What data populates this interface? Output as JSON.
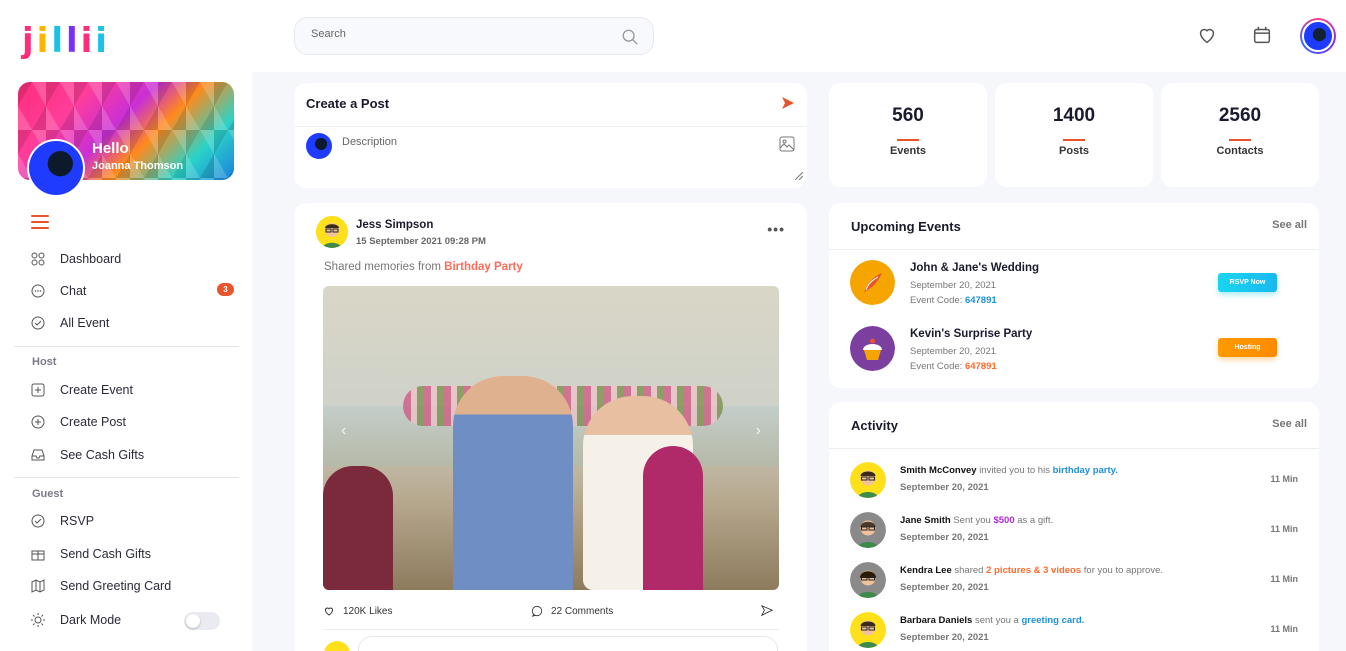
{
  "brand": {
    "logo_text": "jillii"
  },
  "search": {
    "placeholder": "Search"
  },
  "profile": {
    "greeting": "Hello",
    "name": "Joanna Thomson"
  },
  "sidebar": {
    "main_items": [
      {
        "label": "Dashboard",
        "icon": "dashboard-icon"
      },
      {
        "label": "Chat",
        "icon": "chat-icon",
        "badge": "3"
      },
      {
        "label": "All Event",
        "icon": "check-circle-icon"
      }
    ],
    "host_label": "Host",
    "host_items": [
      {
        "label": "Create Event",
        "icon": "plus-square-icon"
      },
      {
        "label": "Create Post",
        "icon": "plus-circle-icon"
      },
      {
        "label": "See Cash Gifts",
        "icon": "inbox-icon"
      }
    ],
    "guest_label": "Guest",
    "guest_items": [
      {
        "label": "RSVP",
        "icon": "check-circle-icon"
      },
      {
        "label": "Send Cash Gifts",
        "icon": "gift-icon"
      },
      {
        "label": "Send Greeting Card",
        "icon": "map-icon"
      }
    ],
    "dark_mode_label": "Dark Mode",
    "dark_mode_on": false
  },
  "create_post": {
    "title": "Create a Post",
    "placeholder": "Description"
  },
  "stats": [
    {
      "value": "560",
      "label": "Events"
    },
    {
      "value": "1400",
      "label": "Posts"
    },
    {
      "value": "2560",
      "label": "Contacts"
    }
  ],
  "post": {
    "author": "Jess Simpson",
    "date": "15 September 2021 09:28 PM",
    "caption_prefix": "Shared memories from",
    "caption_highlight": "Birthday Party",
    "likes": "120K Likes",
    "comments": "22 Comments"
  },
  "upcoming_events": {
    "title": "Upcoming Events",
    "see_all": "See all",
    "items": [
      {
        "title": "John & Jane's Wedding",
        "date": "September 20, 2021",
        "code_label": "Event Code:",
        "code": "647891",
        "code_color": "#1e90d6",
        "button": "RSVP Now"
      },
      {
        "title": "Kevin's Surprise Party",
        "date": "September 20, 2021",
        "code_label": "Event Code:",
        "code": "647891",
        "code_color": "#ff6b2c",
        "button": "Hosting"
      }
    ]
  },
  "activity": {
    "title": "Activity",
    "see_all": "See all",
    "items": [
      {
        "who": "Smith McConvey",
        "text": "invited you to his",
        "highlight": "birthday party.",
        "rest": "",
        "hl_color": "#1e90d6",
        "date": "September 20, 2021",
        "time": "11 Min"
      },
      {
        "who": "Jane Smith",
        "text": "Sent you",
        "highlight": "$500",
        "rest": "as a gift.",
        "hl_color": "#b02ad6",
        "date": "September 20, 2021",
        "time": "11 Min"
      },
      {
        "who": "Kendra Lee",
        "text": "shared",
        "highlight": "2 pictures & 3 videos",
        "rest": "for you to approve.",
        "hl_color": "#ff6b2c",
        "date": "September 20, 2021",
        "time": "11 Min"
      },
      {
        "who": "Barbara Daniels",
        "text": "sent you a",
        "highlight": "greeting card.",
        "rest": "",
        "hl_color": "#1e90d6",
        "date": "September 20, 2021",
        "time": "11 Min"
      }
    ]
  },
  "colors": {
    "accent": "#e8542c",
    "rsvp": "#19d6ef",
    "hosting": "#ff9a00"
  }
}
